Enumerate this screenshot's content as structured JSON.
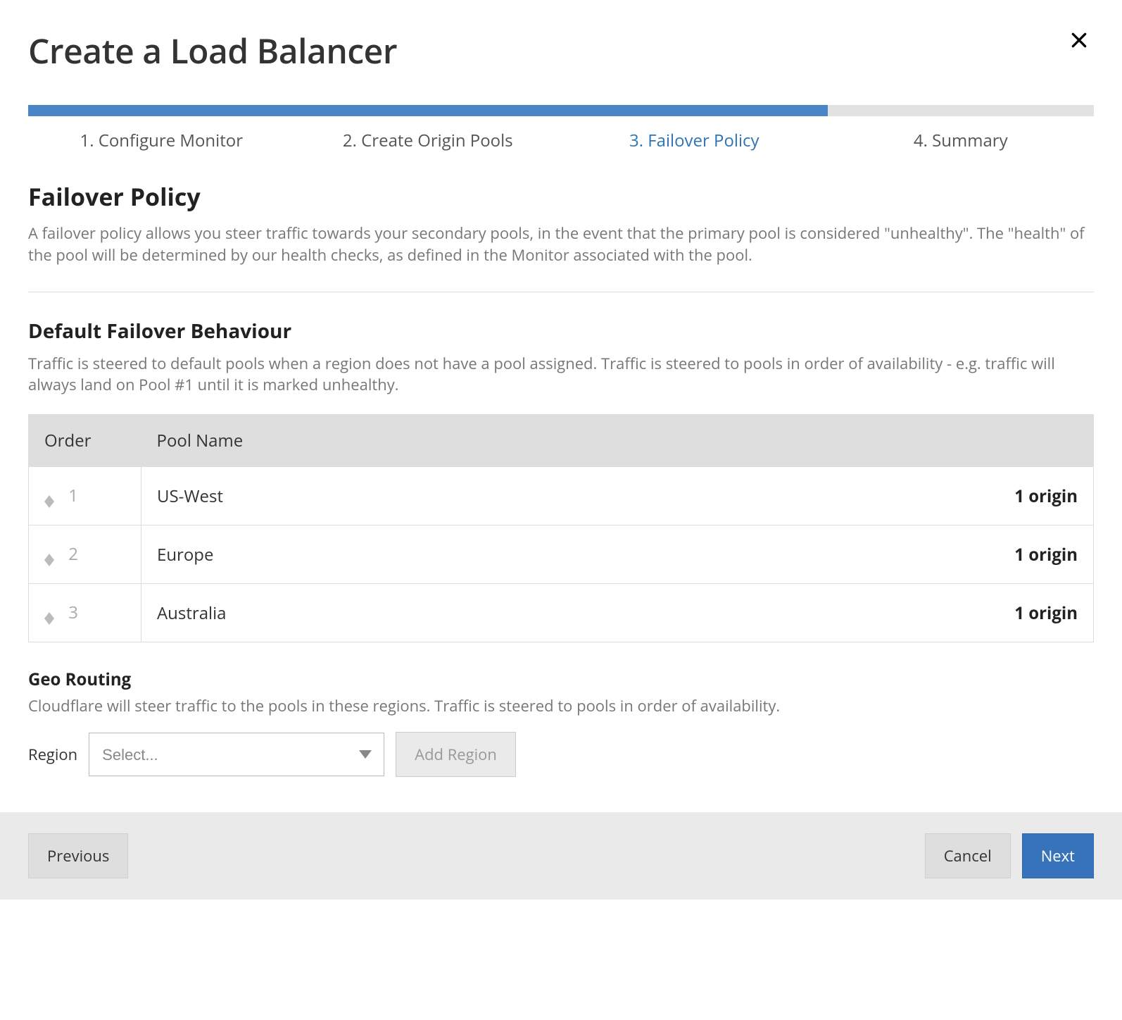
{
  "header": {
    "title": "Create a Load Balancer"
  },
  "progress": {
    "percent": 75
  },
  "steps": [
    {
      "label": "1. Configure Monitor"
    },
    {
      "label": "2. Create Origin Pools"
    },
    {
      "label": "3. Failover Policy",
      "active": true
    },
    {
      "label": "4. Summary"
    }
  ],
  "failover": {
    "title": "Failover Policy",
    "description": "A failover policy allows you steer traffic towards your secondary pools, in the event that the primary pool is considered \"unhealthy\". The \"health\" of the pool will be determined by our health checks, as defined in the Monitor associated with the pool."
  },
  "defaultBehaviour": {
    "title": "Default Failover Behaviour",
    "description": "Traffic is steered to default pools when a region does not have a pool assigned. Traffic is steered to pools in order of availability - e.g. traffic will always land on Pool #1 until it is marked unhealthy.",
    "columns": {
      "order": "Order",
      "poolName": "Pool Name"
    },
    "rows": [
      {
        "order": "1",
        "name": "US-West",
        "origins": "1 origin"
      },
      {
        "order": "2",
        "name": "Europe",
        "origins": "1 origin"
      },
      {
        "order": "3",
        "name": "Australia",
        "origins": "1 origin"
      }
    ]
  },
  "geoRouting": {
    "title": "Geo Routing",
    "description": "Cloudflare will steer traffic to the pools in these regions. Traffic is steered to pools in order of availability.",
    "regionLabel": "Region",
    "selectPlaceholder": "Select...",
    "addRegionLabel": "Add Region"
  },
  "footer": {
    "previous": "Previous",
    "cancel": "Cancel",
    "next": "Next"
  }
}
